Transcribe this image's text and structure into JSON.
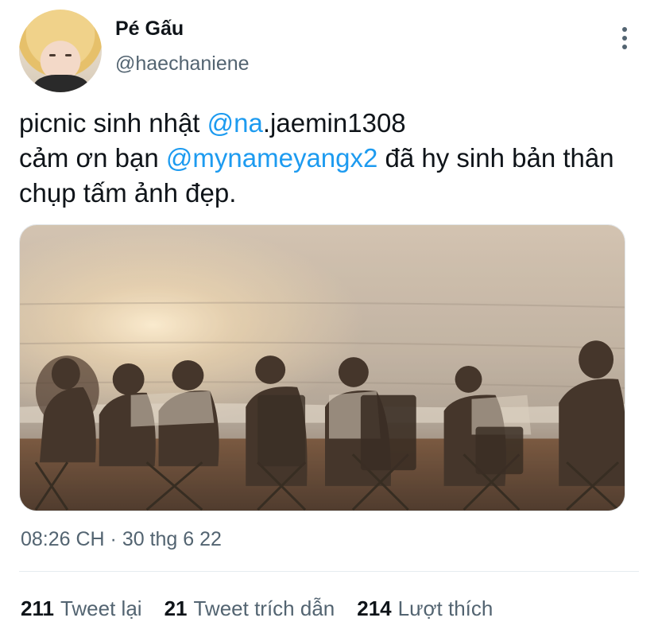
{
  "author": {
    "display_name": "Pé Gấu",
    "handle": "@haechaniene"
  },
  "tweet": {
    "line1_pre": "picnic sinh nhật ",
    "line1_mention": "@na",
    "line1_post": ".jaemin1308",
    "line2_pre": "cảm ơn bạn ",
    "line2_mention": "@mynameyangx2",
    "line2_post": " đã hy sinh bản thân chụp tấm ảnh đẹp.",
    "timestamp": "08:26 CH · 30 thg 6 22"
  },
  "stats": [
    {
      "count": "211",
      "label": "Tweet lại"
    },
    {
      "count": "21",
      "label": "Tweet trích dẫn"
    },
    {
      "count": "214",
      "label": "Lượt thích"
    }
  ],
  "icons": {
    "more": "more-vertical-icon"
  },
  "colors": {
    "mention": "#1d9bf0",
    "secondary_text": "#536471",
    "primary_text": "#0f1419"
  }
}
